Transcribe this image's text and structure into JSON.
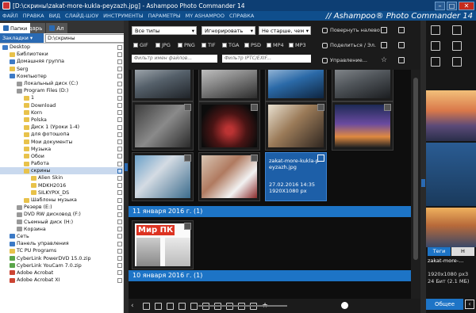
{
  "window": {
    "title": "[D:\\скрины\\zakat-more-kukla-peyzazh.jpg] - Ashampoo Photo Commander 14",
    "brand": "// Ashampoo® Photo Commander 14"
  },
  "menu": [
    "ФАЙЛ",
    "ПРАВКА",
    "ВИД",
    "СЛАЙД-ШОУ",
    "ИНСТРУМЕНТЫ",
    "ПАРАМЕТРЫ",
    "MY ASHAMPOO",
    "СПРАВКА"
  ],
  "left_tabs": [
    {
      "label": "Папки",
      "active": true
    },
    {
      "label": "Календарь",
      "active": false
    },
    {
      "label": "Ал",
      "active": false
    }
  ],
  "bookmarks_label": "Закладки ▾",
  "path_value": "D:\\скрины",
  "tree": [
    {
      "label": "Desktop",
      "indent": 0,
      "icon": "pc"
    },
    {
      "label": "Библиотеки",
      "indent": 1,
      "icon": "folder"
    },
    {
      "label": "Домашняя группа",
      "indent": 1,
      "icon": "pc"
    },
    {
      "label": "Serg",
      "indent": 1,
      "icon": "folder"
    },
    {
      "label": "Компьютер",
      "indent": 1,
      "icon": "pc"
    },
    {
      "label": "Локальный диск (C:)",
      "indent": 2,
      "icon": "disk"
    },
    {
      "label": "Program Files (D:)",
      "indent": 2,
      "icon": "disk"
    },
    {
      "label": "1",
      "indent": 3,
      "icon": "folder"
    },
    {
      "label": "Download",
      "indent": 3,
      "icon": "folder"
    },
    {
      "label": "Korn",
      "indent": 3,
      "icon": "folder"
    },
    {
      "label": "Polska",
      "indent": 3,
      "icon": "folder"
    },
    {
      "label": "Диск 1 (Уроки 1-4)",
      "indent": 3,
      "icon": "folder"
    },
    {
      "label": "для фотошопа",
      "indent": 3,
      "icon": "folder"
    },
    {
      "label": "Мои документы",
      "indent": 3,
      "icon": "folder"
    },
    {
      "label": "Музыка",
      "indent": 3,
      "icon": "folder"
    },
    {
      "label": "Обои",
      "indent": 3,
      "icon": "folder"
    },
    {
      "label": "Работа",
      "indent": 3,
      "icon": "folder"
    },
    {
      "label": "скрины",
      "indent": 3,
      "icon": "folder",
      "selected": true
    },
    {
      "label": "Alien Skin",
      "indent": 4,
      "icon": "folder"
    },
    {
      "label": "MDKH2016",
      "indent": 4,
      "icon": "folder"
    },
    {
      "label": "SILKYPIX_DS",
      "indent": 4,
      "icon": "folder"
    },
    {
      "label": "Шаблоны музыка",
      "indent": 3,
      "icon": "folder"
    },
    {
      "label": "Резерв (E:)",
      "indent": 2,
      "icon": "disk"
    },
    {
      "label": "DVD RW дисковод (F:)",
      "indent": 2,
      "icon": "disk"
    },
    {
      "label": "Съемный диск (H:)",
      "indent": 2,
      "icon": "disk"
    },
    {
      "label": "Корзина",
      "indent": 2,
      "icon": "disk"
    },
    {
      "label": "Сеть",
      "indent": 1,
      "icon": "pc"
    },
    {
      "label": "Панель управления",
      "indent": 1,
      "icon": "pc"
    },
    {
      "label": "TC PU Programs",
      "indent": 1,
      "icon": "folder"
    },
    {
      "label": "CyberLink PowerDVD 15.0.zip",
      "indent": 1,
      "icon": "green"
    },
    {
      "label": "CyberLink YouCam 7.0.zip",
      "indent": 1,
      "icon": "green"
    },
    {
      "label": "Adobe Acrobat",
      "indent": 1,
      "icon": "red"
    },
    {
      "label": "Adobe Acrobat XI",
      "indent": 1,
      "icon": "red"
    }
  ],
  "filters": {
    "type_select": "Все типы",
    "ignore_select": "Игнорировать",
    "age_select": "Не старше, чем",
    "formats": [
      "GIF",
      "JPG",
      "PNG",
      "TIF",
      "TGA",
      "PSD",
      "MP4",
      "MP3"
    ],
    "filename_placeholder": "Фильтр имен файлов...",
    "iptc_placeholder": "Фильтр IPTC/EXIF..."
  },
  "actions": {
    "rotate": "Повернуть налево",
    "share": "Поделиться / Эл.",
    "manage": "Управление..."
  },
  "selected_thumb": {
    "name": "zakat-more-kukla-peyzazh.jpg",
    "date": "27.02.2016 14:35",
    "size": "1920X1080 px"
  },
  "groups": [
    {
      "label": "11 января 2016 г. (1)"
    },
    {
      "label": "10 января 2016 г. (1)"
    }
  ],
  "magazine_label": "Мир ПК",
  "right_panel": {
    "tab_tags": "Теги",
    "tab_h": "H",
    "filename": "zakat-more-...",
    "dims": "1920x1080 px3",
    "bits": "24 Бит (2.1 МБ)",
    "general_button": "Общее"
  },
  "colors": {
    "accent": "#1d74c6",
    "titlebar": "#0d3e73",
    "menubar": "#0f4e8c"
  }
}
